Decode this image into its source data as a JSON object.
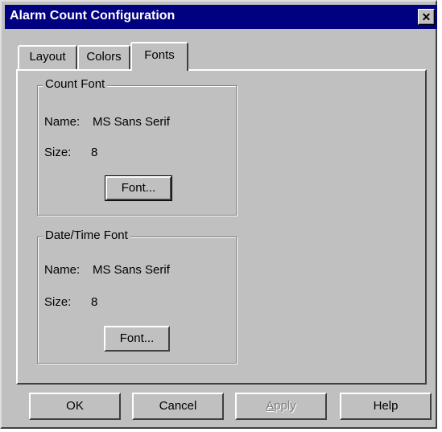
{
  "window": {
    "title": "Alarm Count Configuration",
    "close_glyph": "✕"
  },
  "tabs": [
    {
      "label": "Layout",
      "active": false
    },
    {
      "label": "Colors",
      "active": false
    },
    {
      "label": "Fonts",
      "active": true
    }
  ],
  "count_font": {
    "title": "Count Font",
    "name_label": "Name:",
    "name_value": "MS Sans Serif",
    "size_label": "Size:",
    "size_value": "8",
    "button_label": "Font..."
  },
  "datetime_font": {
    "title": "Date/Time Font",
    "name_label": "Name:",
    "name_value": "MS Sans Serif",
    "size_label": "Size:",
    "size_value": "8",
    "button_label": "Font..."
  },
  "buttons": {
    "ok": "OK",
    "cancel": "Cancel",
    "apply_accel": "A",
    "apply_rest": "pply",
    "help": "Help"
  },
  "colors": {
    "face": "#c0c0c0",
    "titlebar": "#000080",
    "disabled_text": "#808080"
  }
}
